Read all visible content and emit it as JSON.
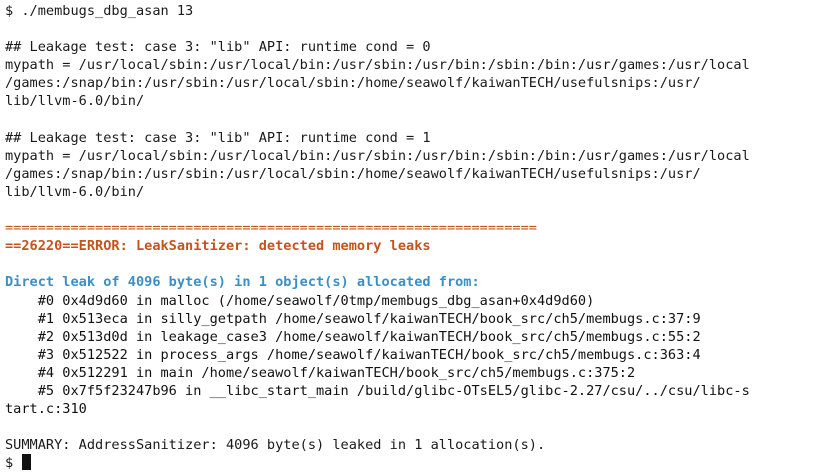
{
  "terminal": {
    "lines": [
      {
        "type": "plain",
        "text": "$ ./membugs_dbg_asan 13"
      },
      {
        "type": "plain",
        "text": ""
      },
      {
        "type": "plain",
        "text": "## Leakage test: case 3: \"lib\" API: runtime cond = 0"
      },
      {
        "type": "plain",
        "text": "mypath = /usr/local/sbin:/usr/local/bin:/usr/sbin:/usr/bin:/sbin:/bin:/usr/games:/usr/local"
      },
      {
        "type": "plain",
        "text": "/games:/snap/bin:/usr/sbin:/usr/local/sbin:/home/seawolf/kaiwanTECH/usefulsnips:/usr/"
      },
      {
        "type": "plain",
        "text": "lib/llvm-6.0/bin/"
      },
      {
        "type": "plain",
        "text": ""
      },
      {
        "type": "plain",
        "text": "## Leakage test: case 3: \"lib\" API: runtime cond = 1"
      },
      {
        "type": "plain",
        "text": "mypath = /usr/local/sbin:/usr/local/bin:/usr/sbin:/usr/bin:/sbin:/bin:/usr/games:/usr/local"
      },
      {
        "type": "plain",
        "text": "/games:/snap/bin:/usr/sbin:/usr/local/sbin:/home/seawolf/kaiwanTECH/usefulsnips:/usr/"
      },
      {
        "type": "plain",
        "text": "lib/llvm-6.0/bin/"
      },
      {
        "type": "plain",
        "text": ""
      },
      {
        "type": "separator",
        "text": "================================================================="
      },
      {
        "type": "error",
        "text": "==26220==ERROR: LeakSanitizer: detected memory leaks"
      },
      {
        "type": "plain",
        "text": ""
      },
      {
        "type": "direct",
        "text": "Direct leak of 4096 byte(s) in 1 object(s) allocated from:"
      },
      {
        "type": "frame",
        "text": "    #0 0x4d9d60 in malloc (/home/seawolf/0tmp/membugs_dbg_asan+0x4d9d60)"
      },
      {
        "type": "frame",
        "text": "    #1 0x513eca in silly_getpath /home/seawolf/kaiwanTECH/book_src/ch5/membugs.c:37:9"
      },
      {
        "type": "frame",
        "text": "    #2 0x513d0d in leakage_case3 /home/seawolf/kaiwanTECH/book_src/ch5/membugs.c:55:2"
      },
      {
        "type": "frame",
        "text": "    #3 0x512522 in process_args /home/seawolf/kaiwanTECH/book_src/ch5/membugs.c:363:4"
      },
      {
        "type": "frame",
        "text": "    #4 0x512291 in main /home/seawolf/kaiwanTECH/book_src/ch5/membugs.c:375:2"
      },
      {
        "type": "frame",
        "text": "    #5 0x7f5f23247b96 in __libc_start_main /build/glibc-OTsEL5/glibc-2.27/csu/../csu/libc-s"
      },
      {
        "type": "frame",
        "text": "tart.c:310"
      },
      {
        "type": "plain",
        "text": ""
      },
      {
        "type": "plain",
        "text": "SUMMARY: AddressSanitizer: 4096 byte(s) leaked in 1 allocation(s)."
      }
    ],
    "prompt": "$ ",
    "colors": {
      "background": "#ffffff",
      "text": "#1a1a1a",
      "error": "#c4541e",
      "direct_leak": "#3c8fc6"
    }
  }
}
